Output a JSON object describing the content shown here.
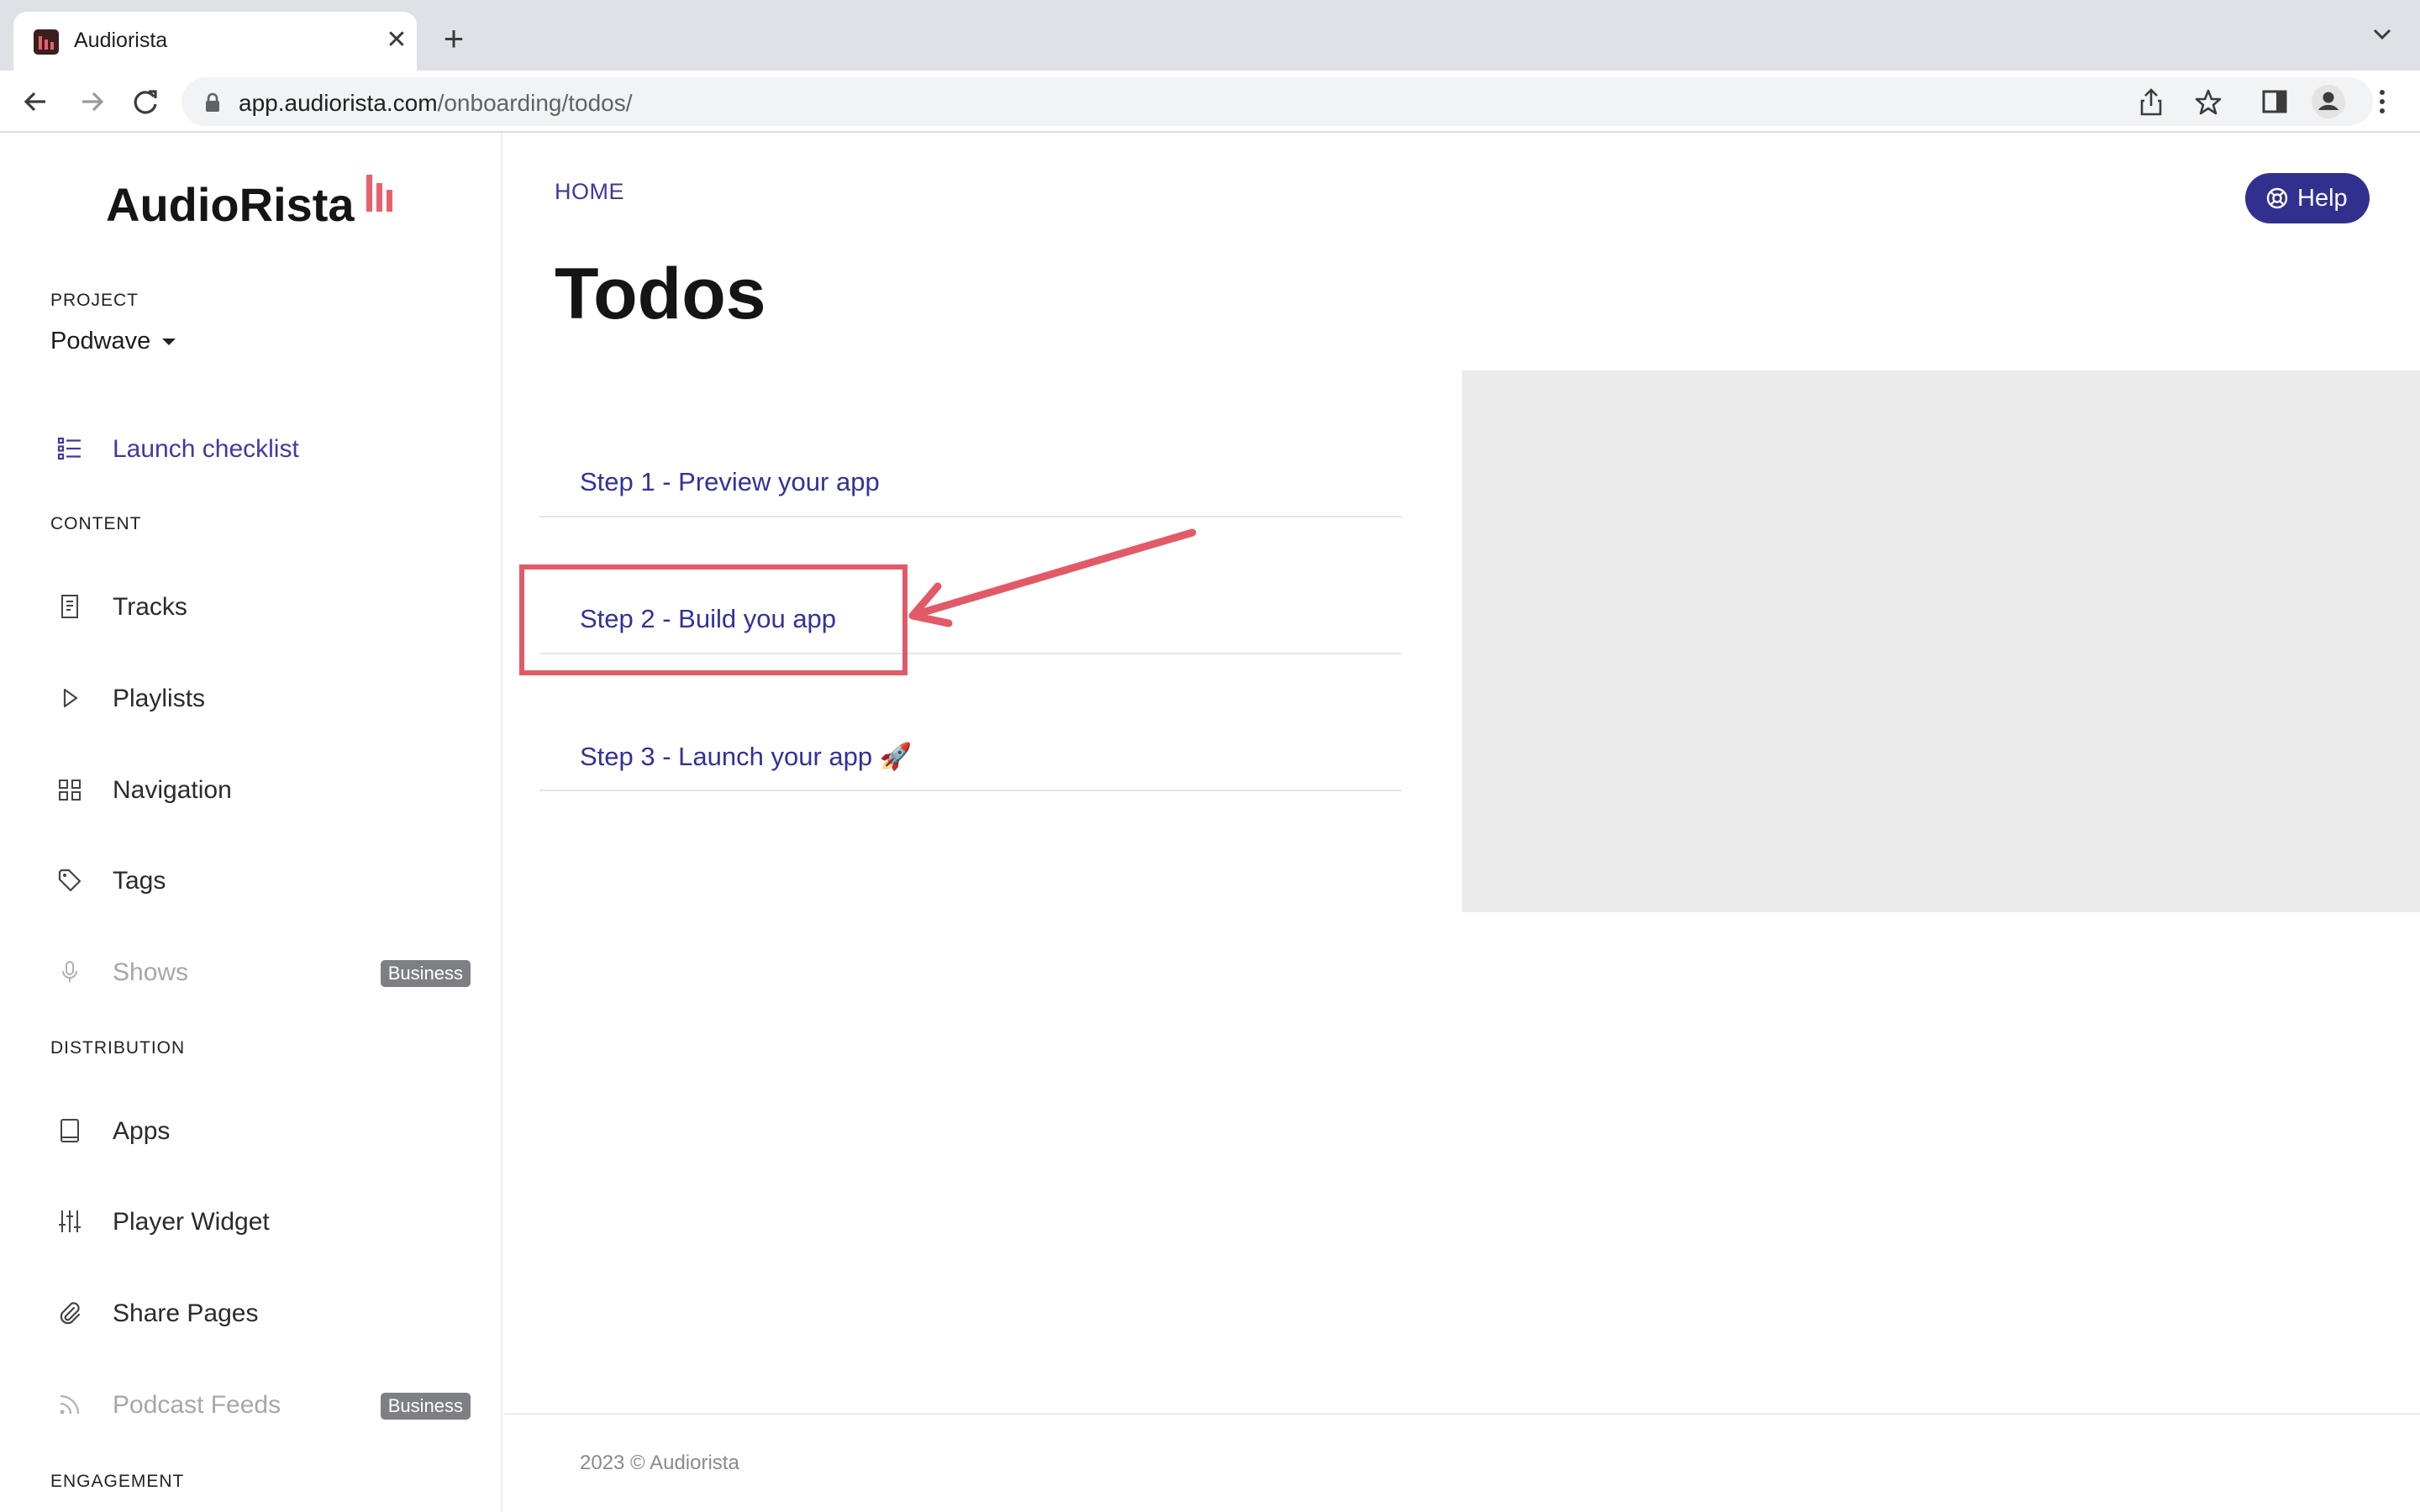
{
  "browser": {
    "tab_title": "Audiorista",
    "url_domain": "app.audiorista.com",
    "url_path": "/onboarding/todos/"
  },
  "sidebar": {
    "logo_text": "AudioRista",
    "project_label": "PROJECT",
    "project_name": "Podwave",
    "launch_checklist": "Launch checklist",
    "content_label": "CONTENT",
    "content_items": [
      {
        "label": "Tracks",
        "icon": "document-icon"
      },
      {
        "label": "Playlists",
        "icon": "play-icon"
      },
      {
        "label": "Navigation",
        "icon": "grid-icon"
      },
      {
        "label": "Tags",
        "icon": "tag-icon"
      },
      {
        "label": "Shows",
        "icon": "microphone-icon",
        "badge": "Business"
      }
    ],
    "distribution_label": "DISTRIBUTION",
    "distribution_items": [
      {
        "label": "Apps",
        "icon": "tablet-icon"
      },
      {
        "label": "Player Widget",
        "icon": "sliders-icon"
      },
      {
        "label": "Share Pages",
        "icon": "paperclip-icon"
      },
      {
        "label": "Podcast Feeds",
        "icon": "rss-icon",
        "badge": "Business"
      }
    ],
    "engagement_label": "ENGAGEMENT"
  },
  "main": {
    "breadcrumb": "HOME",
    "title": "Todos",
    "help_label": "Help",
    "steps": [
      "Step 1 - Preview your app",
      "Step 2 - Build you app",
      "Step 3 - Launch your app 🚀"
    ],
    "footer": "2023 © Audiorista"
  },
  "colors": {
    "accent": "#32308f",
    "link": "#33319a",
    "highlight": "#e25a67",
    "brand": "#e8606c"
  }
}
